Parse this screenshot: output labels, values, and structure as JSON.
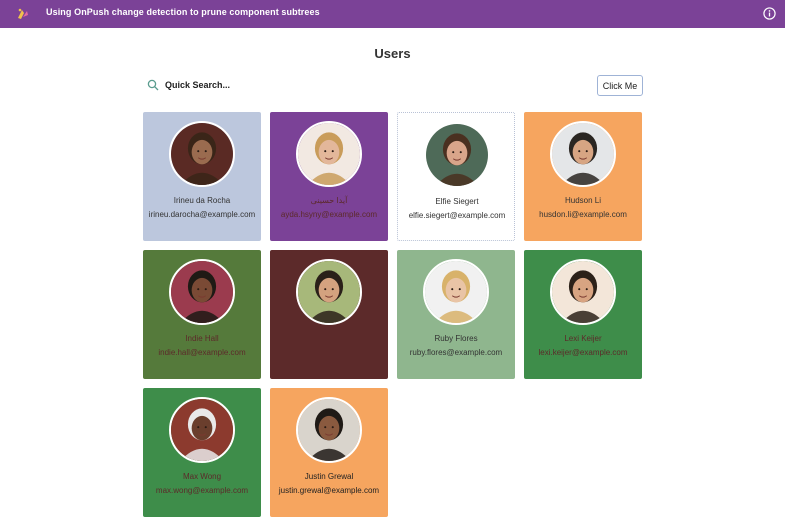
{
  "app": {
    "title": "Using OnPush change detection to prune component subtrees",
    "bar_color": "#7b4297"
  },
  "page": {
    "title": "Users"
  },
  "search": {
    "placeholder": "Quick Search...",
    "value": ""
  },
  "button": {
    "label": "Click Me"
  },
  "users": [
    {
      "name": "Irineu da Rocha",
      "email": "irineu.darocha@example.com",
      "bg": "#bcc7dd",
      "text": "#333333",
      "skin": "#9a6b4f",
      "hair": "#3a2518",
      "backdrop": "#5a2a24"
    },
    {
      "name": "آیدا حسینی",
      "email": "ayda.hsyny@example.com",
      "bg": "#7b4297",
      "text": "#5c2a2a",
      "skin": "#e3b79a",
      "hair": "#c99c5a",
      "backdrop": "#f2e9e2"
    },
    {
      "name": "Elfie Siegert",
      "email": "elfie.siegert@example.com",
      "bg": "#ffffff",
      "text": "#333333",
      "skin": "#d9a58a",
      "hair": "#4a3020",
      "backdrop": "#4e6a58"
    },
    {
      "name": "Hudson Li",
      "email": "husdon.li@example.com",
      "bg": "#f6a55f",
      "text": "#333333",
      "skin": "#d7a583",
      "hair": "#2a2622",
      "backdrop": "#e4e6e8"
    },
    {
      "name": "Indie Hall",
      "email": "indie.hall@example.com",
      "bg": "#557a3b",
      "text": "#5c2a2a",
      "skin": "#7a4a35",
      "hair": "#1f1a15",
      "backdrop": "#9b3b4e"
    },
    {
      "name": "",
      "email": "",
      "bg": "#5c2a2a",
      "text": "#5c2a2a",
      "skin": "#d4a27f",
      "hair": "#2a2019",
      "backdrop": "#a7b87a"
    },
    {
      "name": "Ruby Flores",
      "email": "ruby.flores@example.com",
      "bg": "#8fb68e",
      "text": "#333333",
      "skin": "#e9c4a6",
      "hair": "#d8b26a",
      "backdrop": "#f1f1f1"
    },
    {
      "name": "Lexi Keijer",
      "email": "lexi.keijer@example.com",
      "bg": "#3e8d4a",
      "text": "#5c2a2a",
      "skin": "#d8a482",
      "hair": "#2c2119",
      "backdrop": "#f3e6d9"
    },
    {
      "name": "Max Wong",
      "email": "max.wong@example.com",
      "bg": "#3e8d4a",
      "text": "#5c2a2a",
      "skin": "#6a3e2d",
      "hair": "#e9e9e9",
      "backdrop": "#8c3a2e"
    },
    {
      "name": "Justin Grewal",
      "email": "justin.grewal@example.com",
      "bg": "#f6a55f",
      "text": "#222222",
      "skin": "#8a5a3f",
      "hair": "#1f1a16",
      "backdrop": "#d9d4cc"
    }
  ]
}
